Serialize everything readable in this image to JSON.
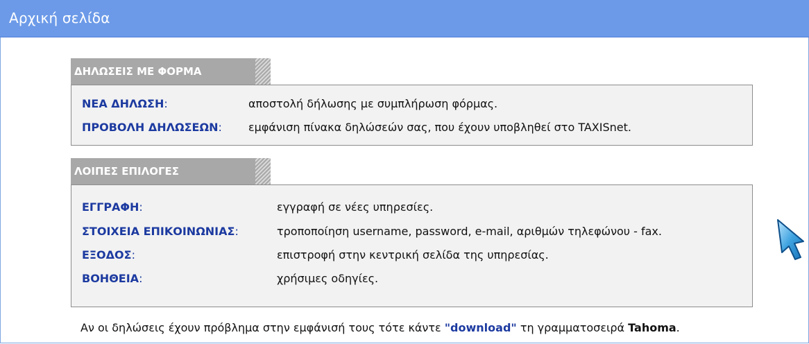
{
  "header": {
    "title": "Αρχική σελίδα"
  },
  "sections": [
    {
      "title": "ΔΗΛΩΣΕΙΣ ΜΕ ΦΟΡΜΑ",
      "items": [
        {
          "label": "ΝΕΑ ΔΗΛΩΣΗ",
          "colon": ":",
          "desc": "αποστολή δήλωσης με συμπλήρωση φόρμας."
        },
        {
          "label": "ΠΡΟΒΟΛΗ ΔΗΛΩΣΕΩΝ",
          "colon": ":",
          "desc": "εμφάνιση πίνακα δηλώσεών σας, που έχουν υποβληθεί στο TAXISnet."
        }
      ]
    },
    {
      "title": "ΛΟΙΠΕΣ ΕΠΙΛΟΓΕΣ",
      "items": [
        {
          "label": "ΕΓΓΡΑΦΗ",
          "colon": ":",
          "desc": "εγγραφή σε νέες υπηρεσίες."
        },
        {
          "label": "ΣΤΟΙΧΕΙΑ ΕΠΙΚΟΙΝΩΝΙΑΣ",
          "colon": ":",
          "desc": "τροποποίηση username, password, e-mail, αριθμών τηλεφώνου - fax."
        },
        {
          "label": "ΕΞΟΔΟΣ",
          "colon": ":",
          "desc": "επιστροφή στην κεντρική σελίδα της υπηρεσίας."
        },
        {
          "label": "ΒΟΗΘΕΙΑ",
          "colon": ":",
          "desc": "χρήσιμες οδηγίες."
        }
      ]
    }
  ],
  "footer": {
    "text_before": "Αν οι δηλώσεις έχουν πρόβλημα στην εμφάνισή τους τότε κάντε ",
    "download_link": "\"download\"",
    "text_middle": " τη γραμματοσειρά ",
    "font_name": "Tahoma",
    "text_after": "."
  },
  "icons": {
    "cursor": "mouse-pointer-icon"
  },
  "colors": {
    "title_bar": "#6c9ae8",
    "link": "#1c3aa0",
    "section_header": "#a8a8a8",
    "section_box": "#f2f2f2"
  }
}
